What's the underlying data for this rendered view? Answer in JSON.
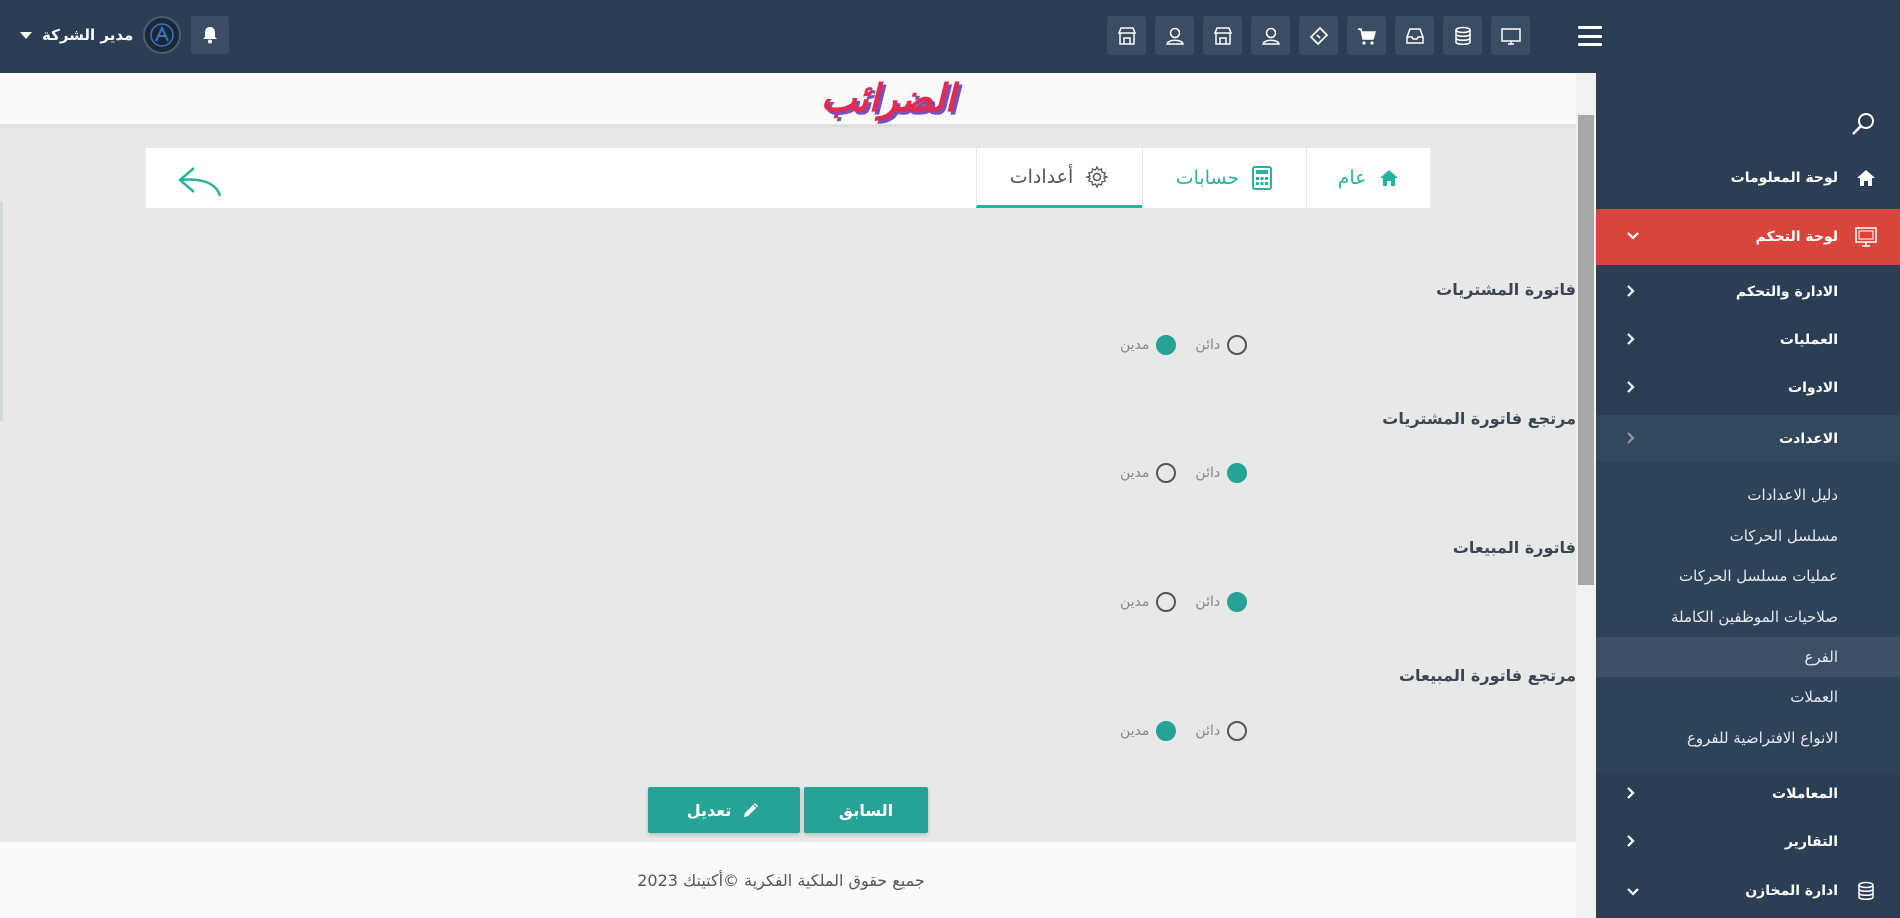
{
  "header": {
    "user_name": "مدير الشركة",
    "icons": [
      "store-icon",
      "user-icon",
      "store-icon",
      "user-icon",
      "ticket-icon",
      "cart-icon",
      "inbox-icon",
      "database-icon",
      "monitor-icon"
    ]
  },
  "page": {
    "title": "الضرائب"
  },
  "tabs": {
    "general": "عام",
    "accounts": "حسابات",
    "settings": "أعدادات"
  },
  "sections": [
    {
      "label": "فاتورة المشتريات",
      "credit": "دائن",
      "debit": "مدين",
      "selected": "debit"
    },
    {
      "label": "مرتجع فاتورة المشتريات",
      "credit": "دائن",
      "debit": "مدين",
      "selected": "credit"
    },
    {
      "label": "فاتورة المبيعات",
      "credit": "دائن",
      "debit": "مدين",
      "selected": "credit"
    },
    {
      "label": "مرتجع فاتورة المبيعات",
      "credit": "دائن",
      "debit": "مدين",
      "selected": "debit"
    }
  ],
  "buttons": {
    "previous": "السابق",
    "edit": "تعديل"
  },
  "footer": {
    "text": "جميع حقوق الملكية الفكرية ©أكتيتك 2023"
  },
  "sidebar": {
    "dashboard": "لوحة المعلومات",
    "control_panel": "لوحة التحكم",
    "items": [
      "الادارة والتحكم",
      "العمليات",
      "الادوات",
      "الاعدادت"
    ],
    "sub_items": [
      "دليل الاعدادات",
      "مسلسل الحركات",
      "عمليات مسلسل الحركات",
      "صلاحيات الموظفين الكاملة",
      "الفرع",
      "العملات",
      "الانواع الافتراضية للفروع"
    ],
    "bottom_items": [
      "المعاملات",
      "التقارير",
      "ادارة المخازن"
    ]
  },
  "colors": {
    "topbar": "#2b3e54",
    "accent": "#26a396",
    "active_menu": "#d9453d",
    "title": "#e52a4f"
  }
}
